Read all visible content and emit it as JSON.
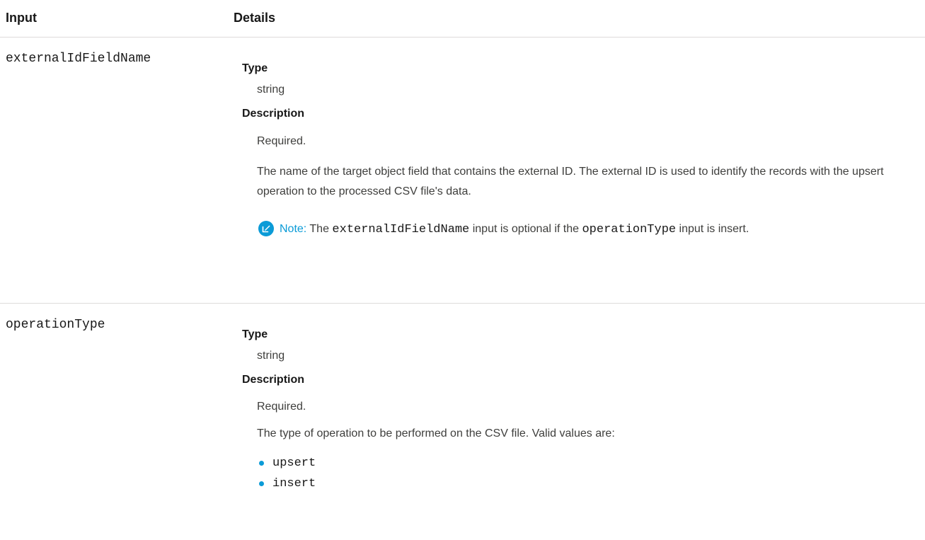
{
  "table": {
    "headers": {
      "input": "Input",
      "details": "Details"
    },
    "rows": [
      {
        "param": "externalIdFieldName",
        "type_label": "Type",
        "type_value": "string",
        "description_label": "Description",
        "required": "Required.",
        "description": "The name of the target object field that contains the external ID. The external ID is used to identify the records with the upsert operation to the processed CSV file's data.",
        "note": {
          "label": "Note:",
          "text_1": " The ",
          "code_1": "externalIdFieldName",
          "text_2": " input is optional if the ",
          "code_2": "operationType",
          "text_3": " input is insert."
        }
      },
      {
        "param": "operationType",
        "type_label": "Type",
        "type_value": "string",
        "description_label": "Description",
        "required": "Required.",
        "description": "The type of operation to be performed on the CSV file. Valid values are:",
        "values": [
          "upsert",
          "insert"
        ]
      }
    ]
  },
  "colors": {
    "accent": "#0b9bd7",
    "divider": "#dddbda",
    "text": "#3e3e3c"
  },
  "icons": {
    "note": "edit-note-icon",
    "bullet": "bullet-dot-icon"
  }
}
